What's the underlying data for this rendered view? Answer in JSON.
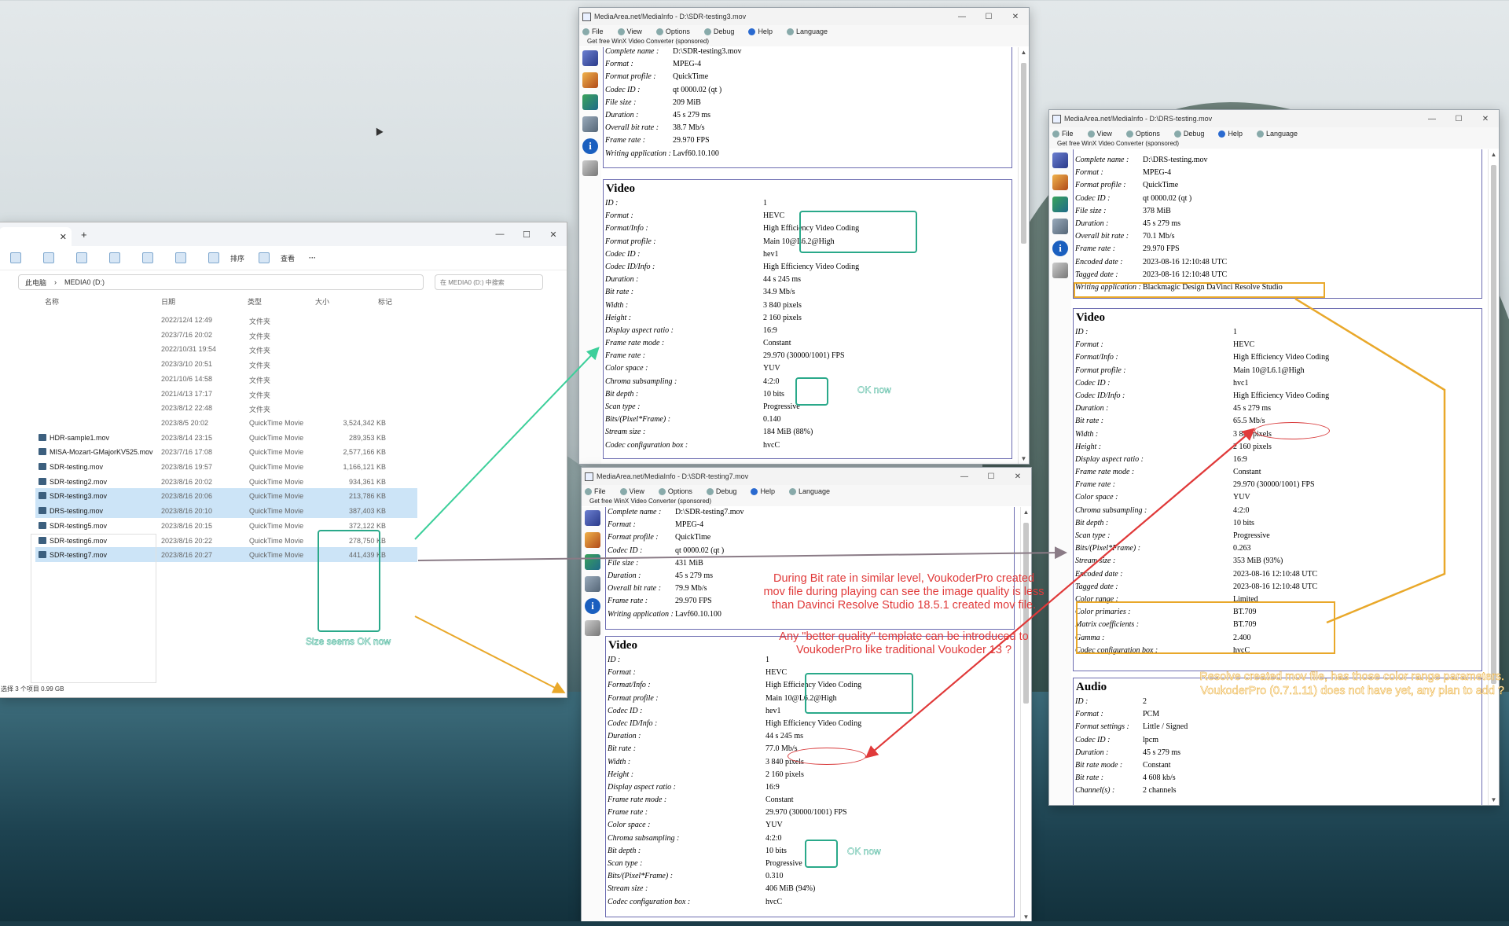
{
  "explorer": {
    "tab_close": "✕",
    "tab_add": "+",
    "win_min": "—",
    "win_max": "☐",
    "win_close": "✕",
    "cmd_sort": "排序",
    "cmd_view": "查看",
    "cmd_more": "···",
    "addr_this_pc": "此电脑",
    "addr_drive": "MEDIA0 (D:)",
    "search_placeholder": "在 MEDIA0 (D:) 中搜索",
    "col_name": "名称",
    "col_date": "日期",
    "col_type": "类型",
    "col_size": "大小",
    "col_tag": "标记",
    "rows": [
      {
        "name": "",
        "date": "2022/12/4 12:49",
        "type": "文件夹",
        "size": ""
      },
      {
        "name": "",
        "date": "2023/7/16 20:02",
        "type": "文件夹",
        "size": ""
      },
      {
        "name": "",
        "date": "2022/10/31 19:54",
        "type": "文件夹",
        "size": ""
      },
      {
        "name": "",
        "date": "2023/3/10 20:51",
        "type": "文件夹",
        "size": ""
      },
      {
        "name": "",
        "date": "2021/10/6 14:58",
        "type": "文件夹",
        "size": ""
      },
      {
        "name": "",
        "date": "2021/4/13 17:17",
        "type": "文件夹",
        "size": ""
      },
      {
        "name": "",
        "date": "2023/8/12 22:48",
        "type": "文件夹",
        "size": ""
      },
      {
        "name": "",
        "date": "2023/8/5 20:02",
        "type": "QuickTime Movie",
        "size": "3,524,342 KB"
      },
      {
        "name": "HDR-sample1.mov",
        "date": "2023/8/14 23:15",
        "type": "QuickTime Movie",
        "size": "289,353 KB"
      },
      {
        "name": "MISA-Mozart-GMajorKV525.mov",
        "date": "2023/7/16 17:08",
        "type": "QuickTime Movie",
        "size": "2,577,166 KB"
      },
      {
        "name": "SDR-testing.mov",
        "date": "2023/8/16 19:57",
        "type": "QuickTime Movie",
        "size": "1,166,121 KB"
      },
      {
        "name": "SDR-testing2.mov",
        "date": "2023/8/16 20:02",
        "type": "QuickTime Movie",
        "size": "934,361 KB"
      },
      {
        "name": "SDR-testing3.mov",
        "date": "2023/8/16 20:06",
        "type": "QuickTime Movie",
        "size": "213,786 KB"
      },
      {
        "name": "DRS-testing.mov",
        "date": "2023/8/16 20:10",
        "type": "QuickTime Movie",
        "size": "387,403 KB"
      },
      {
        "name": "SDR-testing5.mov",
        "date": "2023/8/16 20:15",
        "type": "QuickTime Movie",
        "size": "372,122 KB"
      },
      {
        "name": "SDR-testing6.mov",
        "date": "2023/8/16 20:22",
        "type": "QuickTime Movie",
        "size": "278,750 KB"
      },
      {
        "name": "SDR-testing7.mov",
        "date": "2023/8/16 20:27",
        "type": "QuickTime Movie",
        "size": "441,439 KB"
      }
    ],
    "status": "选择 3 个项目  0.99 GB"
  },
  "mi_menu": {
    "file": "File",
    "view": "View",
    "options": "Options",
    "debug": "Debug",
    "help": "Help",
    "language": "Language",
    "sponsor": "Get free WinX Video Converter (sponsored)",
    "win_min": "—",
    "win_max": "☐",
    "win_close": "✕",
    "scroll_up": "▲",
    "scroll_down": "▼"
  },
  "mi1": {
    "title": "MediaArea.net/MediaInfo - D:\\SDR-testing3.mov",
    "general": [
      [
        "Complete name :",
        "D:\\SDR-testing3.mov"
      ],
      [
        "Format :",
        "MPEG-4"
      ],
      [
        "Format profile :",
        "QuickTime"
      ],
      [
        "Codec ID :",
        "qt 0000.02 (qt )"
      ],
      [
        "File size :",
        "209 MiB"
      ],
      [
        "Duration :",
        "45 s 279 ms"
      ],
      [
        "Overall bit rate :",
        "38.7 Mb/s"
      ],
      [
        "Frame rate :",
        "29.970 FPS"
      ],
      [
        "Writing application :",
        "Lavf60.10.100"
      ]
    ],
    "video_heading": "Video",
    "video": [
      [
        "ID :",
        "1"
      ],
      [
        "Format :",
        "HEVC"
      ],
      [
        "Format/Info :",
        "High Efficiency Video Coding"
      ],
      [
        "Format profile :",
        "Main 10@L6.2@High"
      ],
      [
        "Codec ID :",
        "hev1"
      ],
      [
        "Codec ID/Info :",
        "High Efficiency Video Coding"
      ],
      [
        "Duration :",
        "44 s 245 ms"
      ],
      [
        "Bit rate :",
        "34.9 Mb/s"
      ],
      [
        "Width :",
        "3 840 pixels"
      ],
      [
        "Height :",
        "2 160 pixels"
      ],
      [
        "Display aspect ratio :",
        "16:9"
      ],
      [
        "Frame rate mode :",
        "Constant"
      ],
      [
        "Frame rate :",
        "29.970 (30000/1001) FPS"
      ],
      [
        "Color space :",
        "YUV"
      ],
      [
        "Chroma subsampling :",
        "4:2:0"
      ],
      [
        "Bit depth :",
        "10 bits"
      ],
      [
        "Scan type :",
        "Progressive"
      ],
      [
        "Bits/(Pixel*Frame) :",
        "0.140"
      ],
      [
        "Stream size :",
        "184 MiB (88%)"
      ],
      [
        "Codec configuration box :",
        "hvcC"
      ]
    ]
  },
  "mi2": {
    "title": "MediaArea.net/MediaInfo - D:\\SDR-testing7.mov",
    "general": [
      [
        "Complete name :",
        "D:\\SDR-testing7.mov"
      ],
      [
        "Format :",
        "MPEG-4"
      ],
      [
        "Format profile :",
        "QuickTime"
      ],
      [
        "Codec ID :",
        "qt 0000.02 (qt )"
      ],
      [
        "File size :",
        "431 MiB"
      ],
      [
        "Duration :",
        "45 s 279 ms"
      ],
      [
        "Overall bit rate :",
        "79.9 Mb/s"
      ],
      [
        "Frame rate :",
        "29.970 FPS"
      ],
      [
        "Writing application :",
        "Lavf60.10.100"
      ]
    ],
    "video_heading": "Video",
    "video": [
      [
        "ID :",
        "1"
      ],
      [
        "Format :",
        "HEVC"
      ],
      [
        "Format/Info :",
        "High Efficiency Video Coding"
      ],
      [
        "Format profile :",
        "Main 10@L6.2@High"
      ],
      [
        "Codec ID :",
        "hev1"
      ],
      [
        "Codec ID/Info :",
        "High Efficiency Video Coding"
      ],
      [
        "Duration :",
        "44 s 245 ms"
      ],
      [
        "Bit rate :",
        "77.0 Mb/s"
      ],
      [
        "Width :",
        "3 840 pixels"
      ],
      [
        "Height :",
        "2 160 pixels"
      ],
      [
        "Display aspect ratio :",
        "16:9"
      ],
      [
        "Frame rate mode :",
        "Constant"
      ],
      [
        "Frame rate :",
        "29.970 (30000/1001) FPS"
      ],
      [
        "Color space :",
        "YUV"
      ],
      [
        "Chroma subsampling :",
        "4:2:0"
      ],
      [
        "Bit depth :",
        "10 bits"
      ],
      [
        "Scan type :",
        "Progressive"
      ],
      [
        "Bits/(Pixel*Frame) :",
        "0.310"
      ],
      [
        "Stream size :",
        "406 MiB (94%)"
      ],
      [
        "Codec configuration box :",
        "hvcC"
      ]
    ]
  },
  "mi3": {
    "title": "MediaArea.net/MediaInfo - D:\\DRS-testing.mov",
    "sponsor": "Get free WinX Video Converter (sponsored)",
    "general": [
      [
        "Complete name :",
        "D:\\DRS-testing.mov"
      ],
      [
        "Format :",
        "MPEG-4"
      ],
      [
        "Format profile :",
        "QuickTime"
      ],
      [
        "Codec ID :",
        "qt 0000.02 (qt )"
      ],
      [
        "File size :",
        "378 MiB"
      ],
      [
        "Duration :",
        "45 s 279 ms"
      ],
      [
        "Overall bit rate :",
        "70.1 Mb/s"
      ],
      [
        "Frame rate :",
        "29.970 FPS"
      ],
      [
        "Encoded date :",
        "2023-08-16 12:10:48 UTC"
      ],
      [
        "Tagged date :",
        "2023-08-16 12:10:48 UTC"
      ],
      [
        "Writing application :",
        "Blackmagic Design DaVinci Resolve Studio"
      ]
    ],
    "video_heading": "Video",
    "video": [
      [
        "ID :",
        "1"
      ],
      [
        "Format :",
        "HEVC"
      ],
      [
        "Format/Info :",
        "High Efficiency Video Coding"
      ],
      [
        "Format profile :",
        "Main 10@L6.1@High"
      ],
      [
        "Codec ID :",
        "hvc1"
      ],
      [
        "Codec ID/Info :",
        "High Efficiency Video Coding"
      ],
      [
        "Duration :",
        "45 s 279 ms"
      ],
      [
        "Bit rate :",
        "65.5 Mb/s"
      ],
      [
        "Width :",
        "3 840 pixels"
      ],
      [
        "Height :",
        "2 160 pixels"
      ],
      [
        "Display aspect ratio :",
        "16:9"
      ],
      [
        "Frame rate mode :",
        "Constant"
      ],
      [
        "Frame rate :",
        "29.970 (30000/1001) FPS"
      ],
      [
        "Color space :",
        "YUV"
      ],
      [
        "Chroma subsampling :",
        "4:2:0"
      ],
      [
        "Bit depth :",
        "10 bits"
      ],
      [
        "Scan type :",
        "Progressive"
      ],
      [
        "Bits/(Pixel*Frame) :",
        "0.263"
      ],
      [
        "Stream size :",
        "353 MiB (93%)"
      ],
      [
        "Encoded date :",
        "2023-08-16 12:10:48 UTC"
      ],
      [
        "Tagged date :",
        "2023-08-16 12:10:48 UTC"
      ],
      [
        "Color range :",
        "Limited"
      ],
      [
        "Color primaries :",
        "BT.709"
      ],
      [
        "Matrix coefficients :",
        "BT.709"
      ],
      [
        "Gamma :",
        "2.400"
      ],
      [
        "Codec configuration box :",
        "hvcC"
      ]
    ],
    "audio_heading": "Audio",
    "audio": [
      [
        "ID :",
        "2"
      ],
      [
        "Format :",
        "PCM"
      ],
      [
        "Format settings :",
        "Little / Signed"
      ],
      [
        "Codec ID :",
        "lpcm"
      ],
      [
        "Duration :",
        "45 s 279 ms"
      ],
      [
        "Bit rate mode :",
        "Constant"
      ],
      [
        "Bit rate :",
        "4 608 kb/s"
      ],
      [
        "Channel(s) :",
        "2 channels"
      ]
    ]
  },
  "annotations": {
    "ok_now_1": "OK now",
    "ok_now_2": "OK now",
    "size_ok": "Size seems OK now",
    "red_note_line1": "During Bit rate in similar level, VoukoderPro created",
    "red_note_line2": "mov file during playing can see the image quality is less",
    "red_note_line3": "than Davinci Resolve Studio 18.5.1 created mov file.",
    "red_question_line1": "Any \"better quality\" template can be introduced to",
    "red_question_line2": "VoukoderPro like traditional Voukoder 13 ?",
    "orange_note_line1": "Resolve created mov file, has those color range parameters.",
    "orange_note_line2": "VoukoderPro (0.7.1.11) does not have yet, any plan to add ?",
    "colors": {
      "green": "#2aa98a",
      "red": "#e03a3a",
      "orange": "#e9a82a",
      "gray_arrow": "#8a7b86"
    }
  }
}
